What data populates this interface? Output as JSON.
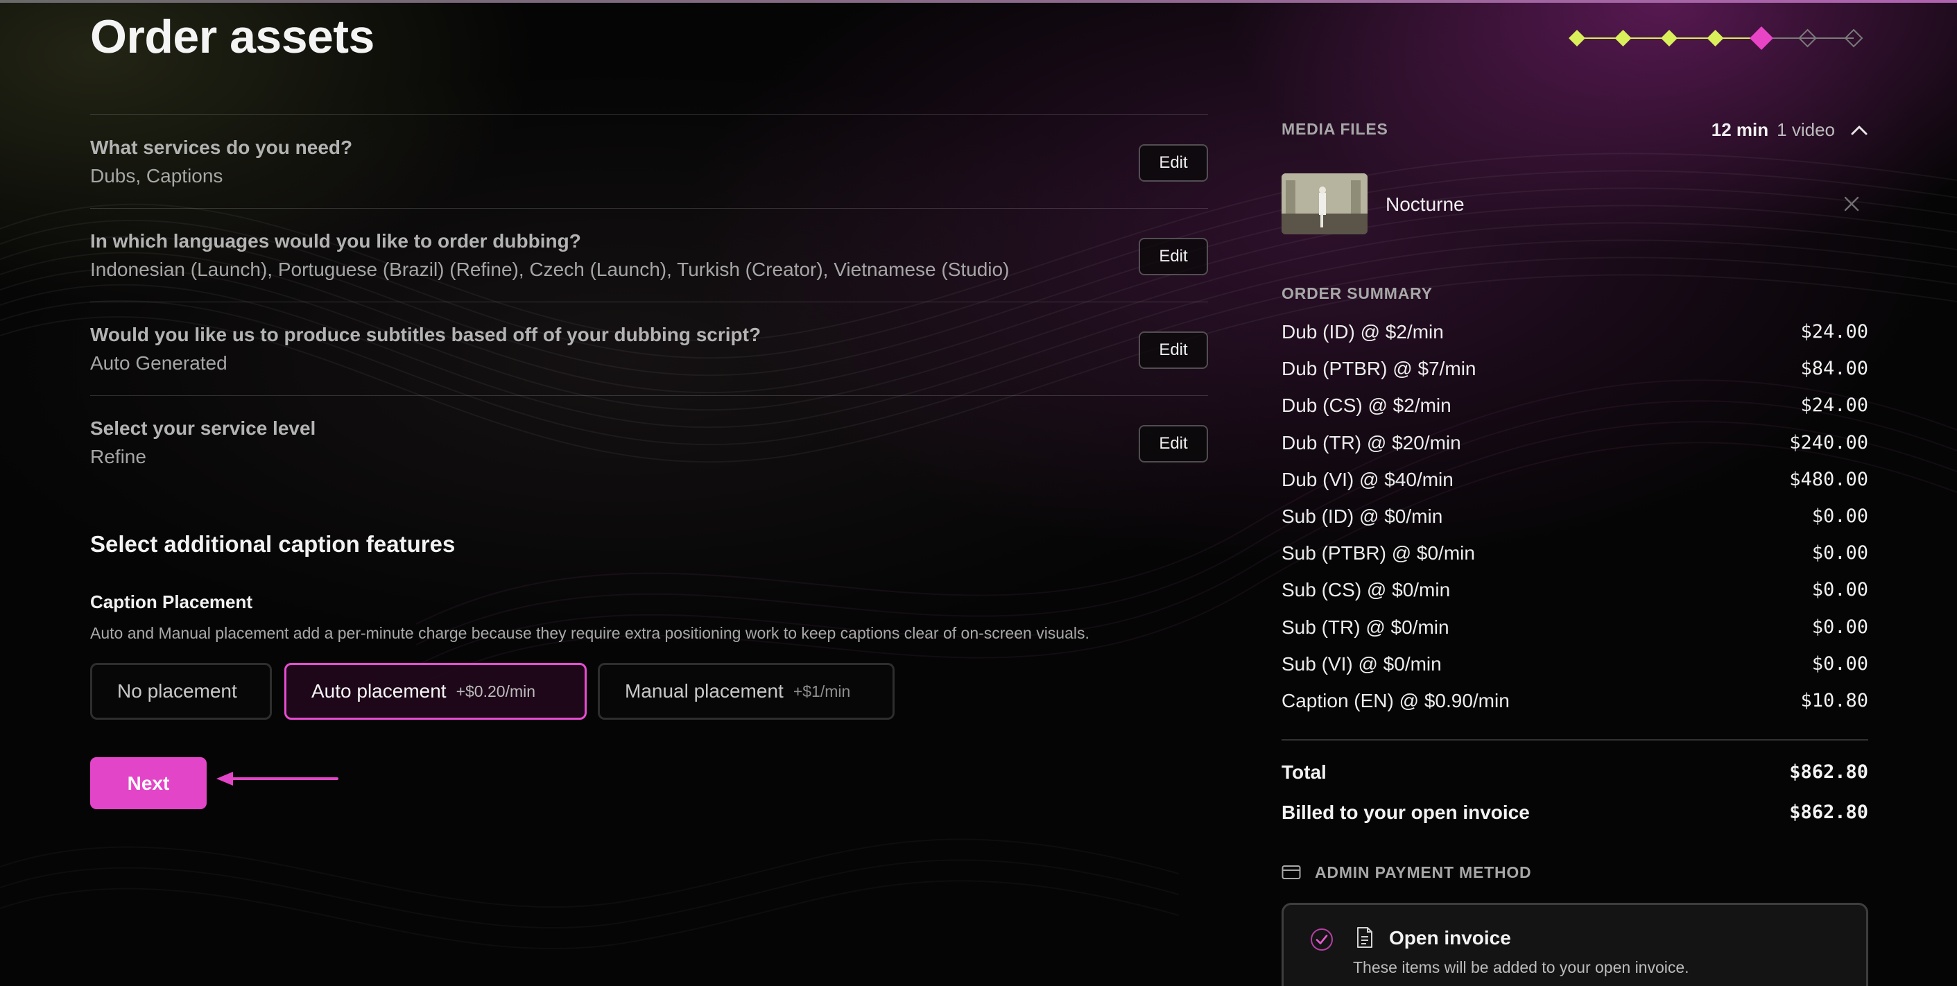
{
  "page": {
    "title": "Order assets"
  },
  "progress": {
    "steps_total": 7,
    "steps_completed": 4,
    "current_step": 5,
    "completed_color": "#d9f05a",
    "current_color": "#e845c6",
    "pending_color": "#7a7a7a"
  },
  "review": [
    {
      "question": "What services do you need?",
      "answer": "Dubs, Captions",
      "edit_label": "Edit"
    },
    {
      "question": "In which languages would you like to order dubbing?",
      "answer": "Indonesian (Launch), Portuguese (Brazil) (Refine), Czech (Launch), Turkish (Creator), Vietnamese (Studio)",
      "edit_label": "Edit"
    },
    {
      "question": "Would you like us to produce subtitles based off of your dubbing script?",
      "answer": "Auto Generated",
      "edit_label": "Edit"
    },
    {
      "question": "Select your service level",
      "answer": "Refine",
      "edit_label": "Edit"
    }
  ],
  "captions": {
    "section_title": "Select additional caption features",
    "placement_title": "Caption Placement",
    "placement_description": "Auto and Manual placement add a per-minute charge because they require extra positioning work to keep captions clear of on-screen visuals.",
    "options": [
      {
        "label": "No placement",
        "price": "",
        "selected": false
      },
      {
        "label": "Auto placement",
        "price": "+$0.20/min",
        "selected": true
      },
      {
        "label": "Manual placement",
        "price": "+$1/min",
        "selected": false
      }
    ]
  },
  "actions": {
    "next_label": "Next",
    "accent_color": "#e345c8"
  },
  "media": {
    "heading": "MEDIA FILES",
    "duration": "12 min",
    "count": "1 video",
    "files": [
      {
        "name": "Nocturne",
        "remove_icon": "close-icon"
      }
    ]
  },
  "summary": {
    "heading": "ORDER SUMMARY",
    "lines": [
      {
        "label": "Dub (ID) @ $2/min",
        "amount": "$24.00"
      },
      {
        "label": "Dub (PTBR) @ $7/min",
        "amount": "$84.00"
      },
      {
        "label": "Dub (CS) @ $2/min",
        "amount": "$24.00"
      },
      {
        "label": "Dub (TR) @ $20/min",
        "amount": "$240.00"
      },
      {
        "label": "Dub (VI) @ $40/min",
        "amount": "$480.00"
      },
      {
        "label": "Sub (ID) @ $0/min",
        "amount": "$0.00"
      },
      {
        "label": "Sub (PTBR) @ $0/min",
        "amount": "$0.00"
      },
      {
        "label": "Sub (CS) @ $0/min",
        "amount": "$0.00"
      },
      {
        "label": "Sub (TR) @ $0/min",
        "amount": "$0.00"
      },
      {
        "label": "Sub (VI) @ $0/min",
        "amount": "$0.00"
      },
      {
        "label": "Caption (EN) @ $0.90/min",
        "amount": "$10.80"
      }
    ],
    "total_label": "Total",
    "total_amount": "$862.80",
    "billed_label": "Billed to your open invoice",
    "billed_amount": "$862.80"
  },
  "payment": {
    "heading": "ADMIN PAYMENT METHOD",
    "method_title": "Open invoice",
    "method_description": "These items will be added to your open invoice.",
    "icons": [
      "credit-card-icon",
      "check-circle-icon",
      "document-icon"
    ]
  }
}
